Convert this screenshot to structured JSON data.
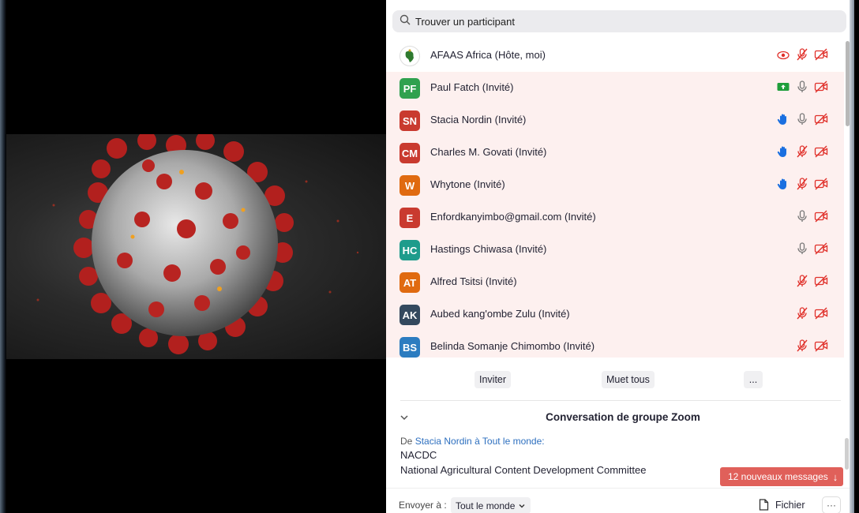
{
  "search": {
    "placeholder": "Trouver un participant"
  },
  "participants": [
    {
      "initials": "",
      "name": "AFAAS Africa (Hôte, moi)",
      "avatar_color": "#ffffff",
      "guest": false,
      "icons": [
        "screen-share-off-icon",
        "mic-muted-icon",
        "video-off-icon"
      ]
    },
    {
      "initials": "PF",
      "name": "Paul Fatch (Invité)",
      "avatar_color": "#2fa14f",
      "guest": true,
      "icons": [
        "screen-share-icon",
        "mic-icon",
        "video-off-icon"
      ]
    },
    {
      "initials": "SN",
      "name": "Stacia Nordin (Invité)",
      "avatar_color": "#c93a2f",
      "guest": true,
      "icons": [
        "raised-hand-icon",
        "mic-icon",
        "video-off-icon"
      ]
    },
    {
      "initials": "CM",
      "name": "Charles M. Govati (Invité)",
      "avatar_color": "#c93a2f",
      "guest": true,
      "icons": [
        "raised-hand-icon",
        "mic-muted-icon",
        "video-off-icon"
      ]
    },
    {
      "initials": "W",
      "name": "Whytone (Invité)",
      "avatar_color": "#e06a10",
      "guest": true,
      "icons": [
        "raised-hand-icon",
        "mic-muted-icon",
        "video-off-icon"
      ]
    },
    {
      "initials": "E",
      "name": "Enfordkanyimbo@gmail.com (Invité)",
      "avatar_color": "#c93a2f",
      "guest": true,
      "icons": [
        "mic-icon",
        "video-off-icon"
      ]
    },
    {
      "initials": "HC",
      "name": "Hastings Chiwasa (Invité)",
      "avatar_color": "#1e9c8c",
      "guest": true,
      "icons": [
        "mic-icon",
        "video-off-icon"
      ]
    },
    {
      "initials": "AT",
      "name": "Alfred Tsitsi (Invité)",
      "avatar_color": "#e06a10",
      "guest": true,
      "icons": [
        "mic-muted-icon",
        "video-off-icon"
      ]
    },
    {
      "initials": "AK",
      "name": "Aubed kang'ombe Zulu (Invité)",
      "avatar_color": "#34495e",
      "guest": true,
      "icons": [
        "mic-muted-icon",
        "video-off-icon"
      ]
    },
    {
      "initials": "BS",
      "name": "Belinda Somanje Chimombo (Invité)",
      "avatar_color": "#2c7cc0",
      "guest": true,
      "icons": [
        "mic-muted-icon",
        "video-off-icon"
      ]
    }
  ],
  "actions": {
    "invite": "Inviter",
    "mute_all": "Muet tous",
    "more": "..."
  },
  "chat": {
    "title": "Conversation de groupe Zoom",
    "meta_from": "De",
    "sender": "Stacia Nordin",
    "meta_to": "à",
    "recipient": "Tout le monde:",
    "line1": "NACDC",
    "line2": "National Agricultural Content Development Committee",
    "new_messages": "12 nouveaux messages"
  },
  "footer": {
    "send_to_label": "Envoyer à :",
    "send_to_value": "Tout le monde",
    "file": "Fichier",
    "more": "···"
  },
  "colors": {
    "muted_red": "#e0302a",
    "hand_blue": "#1a6fe0",
    "share_green": "#1f9e3b",
    "guest_bg": "#fdf0ef"
  }
}
